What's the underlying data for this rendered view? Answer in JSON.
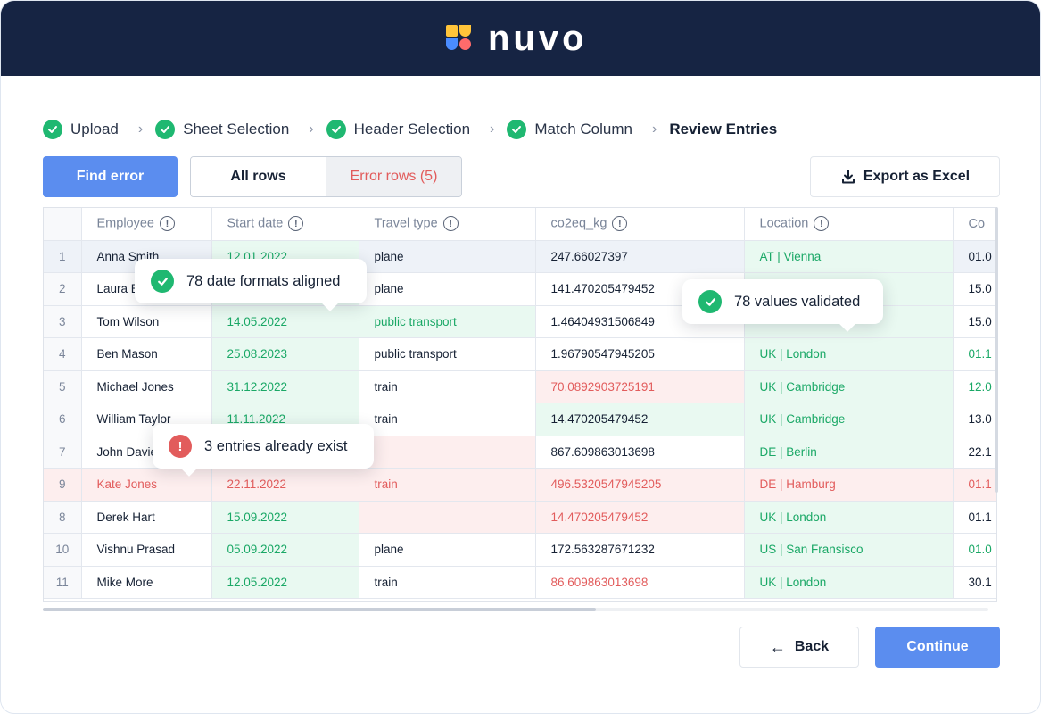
{
  "brand": {
    "name": "nuvo"
  },
  "steps": [
    {
      "label": "Upload",
      "done": true
    },
    {
      "label": "Sheet Selection",
      "done": true
    },
    {
      "label": "Header Selection",
      "done": true
    },
    {
      "label": "Match Column",
      "done": true
    },
    {
      "label": "Review Entries",
      "done": false
    }
  ],
  "toolbar": {
    "find_error": "Find error",
    "all_rows": "All rows",
    "error_rows": "Error rows (5)",
    "export": "Export as Excel"
  },
  "table": {
    "columns": [
      "Employee",
      "Start date",
      "Travel type",
      "co2eq_kg",
      "Location",
      "Co"
    ],
    "rows": [
      {
        "n": "1",
        "employee": "Anna Smith",
        "start": "12.01.2022",
        "travel": "plane",
        "co2": "247.66027397",
        "location": "AT | Vienna",
        "extra": "01.0"
      },
      {
        "n": "2",
        "employee": "Laura B",
        "start": "",
        "travel": "plane",
        "co2": "141.470205479452",
        "location": "",
        "extra": "15.0"
      },
      {
        "n": "3",
        "employee": "Tom Wilson",
        "start": "14.05.2022",
        "travel": "public transport",
        "co2": "1.46404931506849",
        "location": "",
        "extra": "15.0"
      },
      {
        "n": "4",
        "employee": "Ben Mason",
        "start": "25.08.2023",
        "travel": "public transport",
        "co2": "1.96790547945205",
        "location": "UK | London",
        "extra": "01.1"
      },
      {
        "n": "5",
        "employee": "Michael Jones",
        "start": "31.12.2022",
        "travel": "train",
        "co2": "70.0892903725191",
        "location": "UK | Cambridge",
        "extra": "12.0"
      },
      {
        "n": "6",
        "employee": "William Taylor",
        "start": "11.11.2022",
        "travel": "train",
        "co2": "14.470205479452",
        "location": "UK | Cambridge",
        "extra": "13.0"
      },
      {
        "n": "7",
        "employee": "John Davie",
        "start": "",
        "travel": "",
        "co2": "867.609863013698",
        "location": "DE | Berlin",
        "extra": "22.1"
      },
      {
        "n": "9",
        "employee": "Kate Jones",
        "start": "22.11.2022",
        "travel": "train",
        "co2": "496.5320547945205",
        "location": "DE | Hamburg",
        "extra": "01.1"
      },
      {
        "n": "8",
        "employee": "Derek Hart",
        "start": "15.09.2022",
        "travel": "",
        "co2": "14.470205479452",
        "location": "UK | London",
        "extra": "01.1"
      },
      {
        "n": "10",
        "employee": "Vishnu Prasad",
        "start": "05.09.2022",
        "travel": "plane",
        "co2": "172.563287671232",
        "location": "US | San Fransisco",
        "extra": "01.0"
      },
      {
        "n": "11",
        "employee": "Mike More",
        "start": "12.05.2022",
        "travel": "train",
        "co2": "86.609863013698",
        "location": "UK | London",
        "extra": "30.1"
      }
    ]
  },
  "tooltips": {
    "dates": "78 date formats aligned",
    "values": "78 values validated",
    "duplicates": "3 entries already exist"
  },
  "footer": {
    "back": "Back",
    "continue": "Continue"
  },
  "colors": {
    "accent": "#5b8def",
    "header_bg": "#162443",
    "success": "#1fb871",
    "error": "#e25c5c"
  }
}
